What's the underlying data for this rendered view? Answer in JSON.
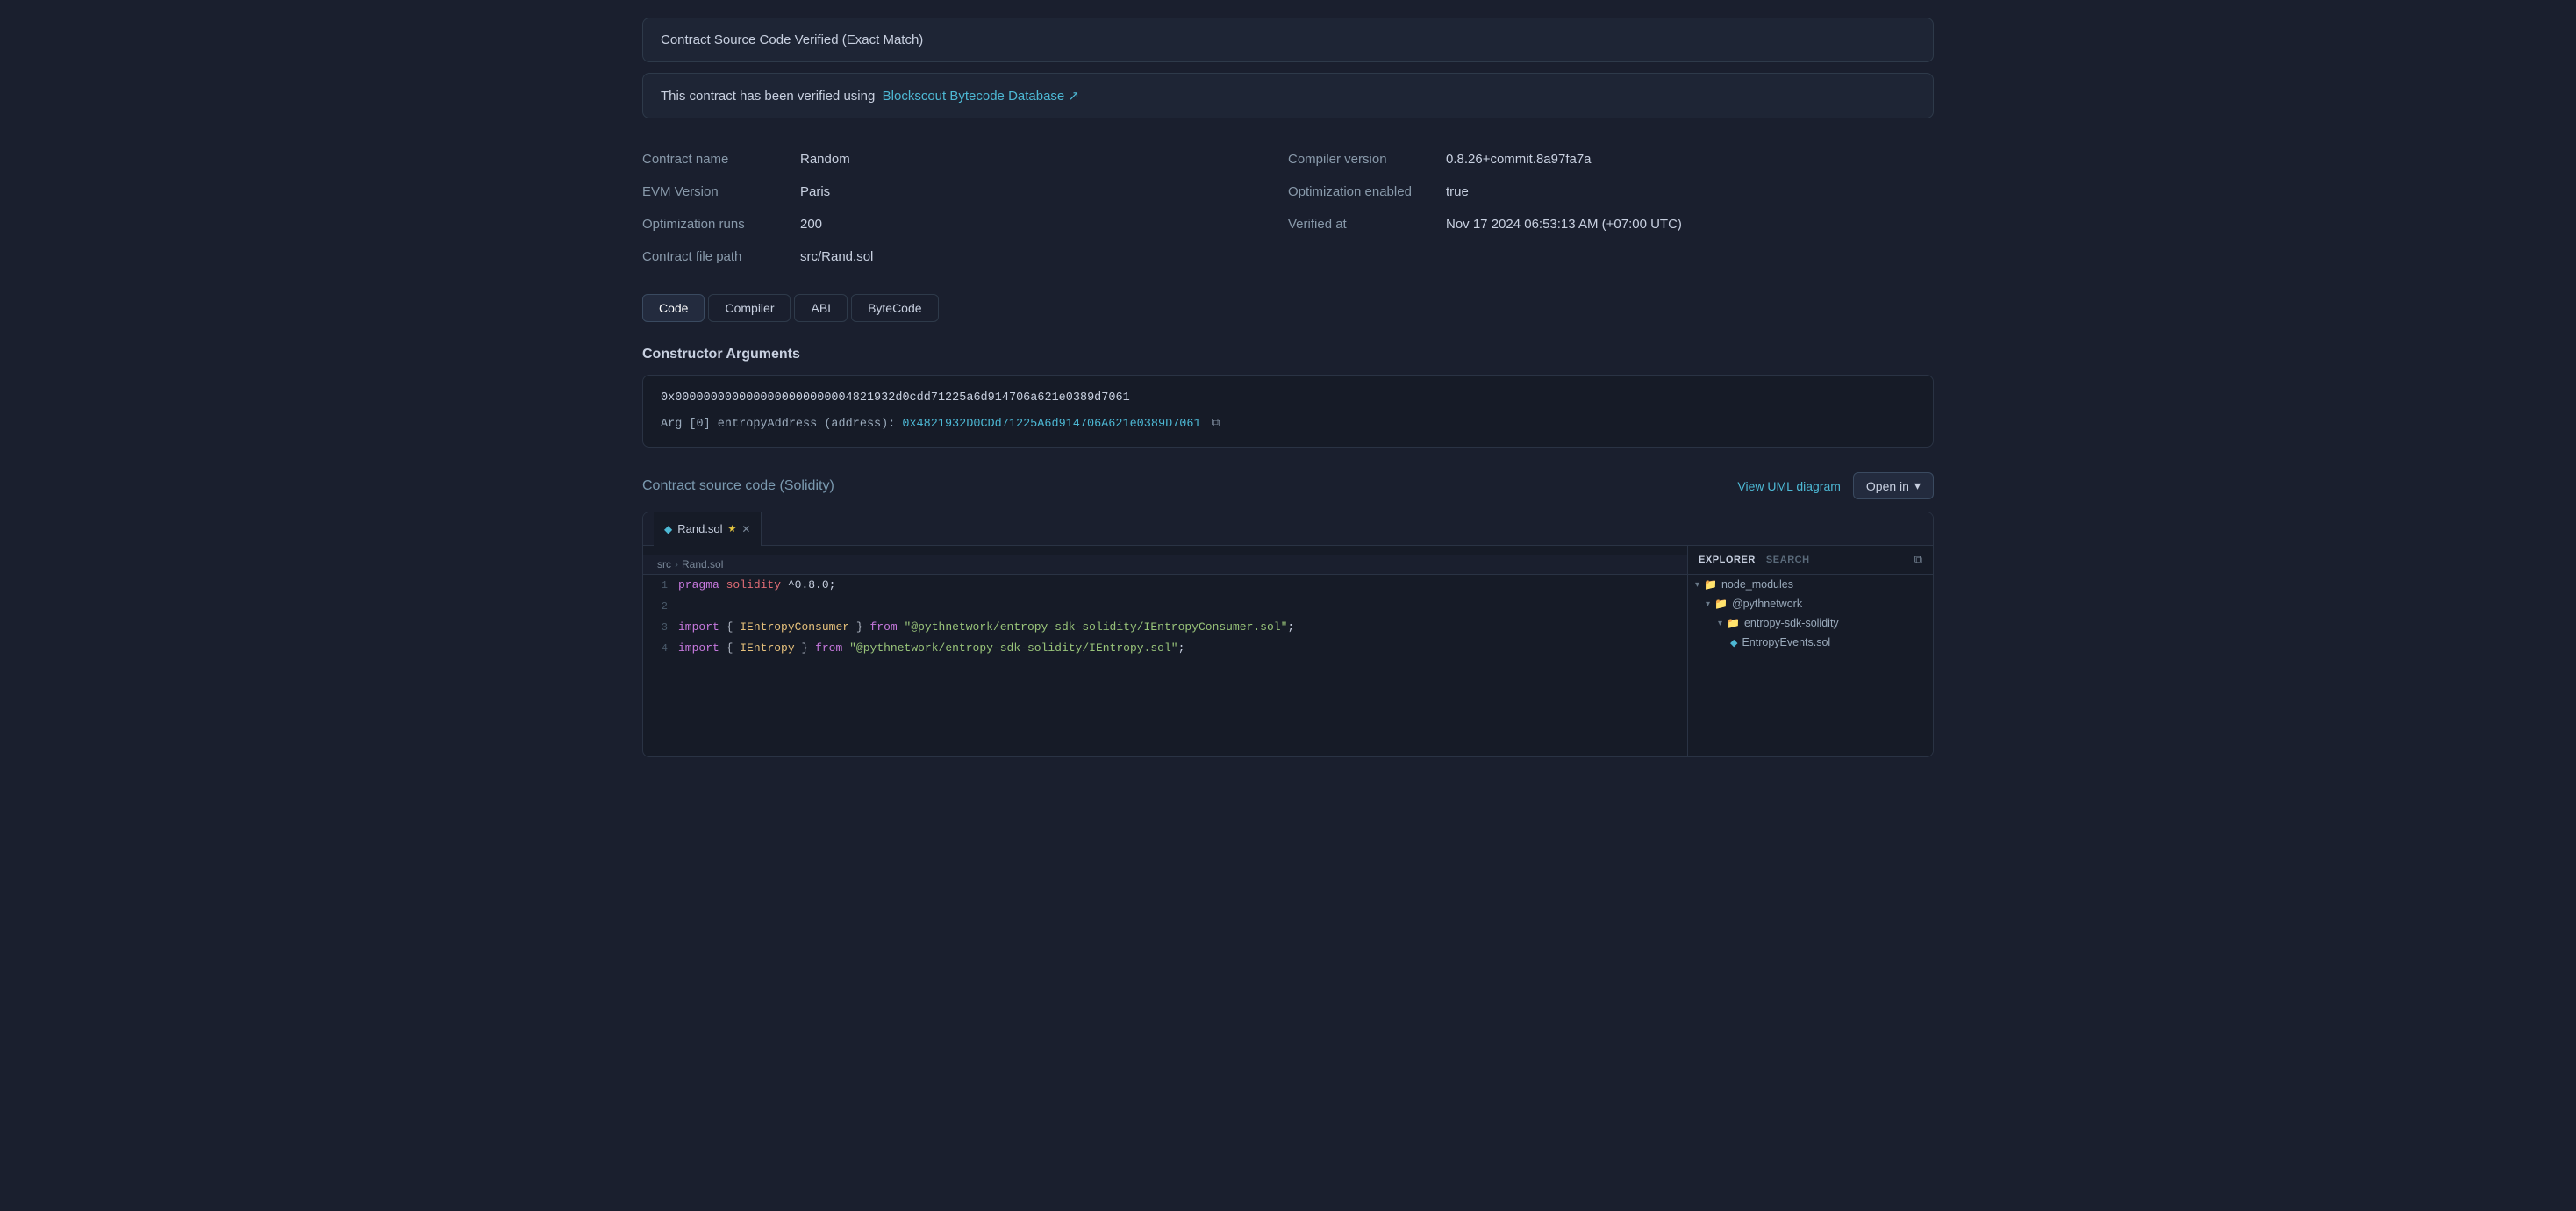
{
  "alerts": {
    "verified": "Contract Source Code Verified (Exact Match)",
    "bytecodeDb": "This contract has been verified using",
    "bytecodeLink": "Blockscout Bytecode Database ↗"
  },
  "contractInfo": {
    "left": [
      {
        "label": "Contract name",
        "value": "Random"
      },
      {
        "label": "EVM Version",
        "value": "Paris"
      },
      {
        "label": "Optimization runs",
        "value": "200"
      },
      {
        "label": "Contract file path",
        "value": "src/Rand.sol"
      }
    ],
    "right": [
      {
        "label": "Compiler version",
        "value": "0.8.26+commit.8a97fa7a"
      },
      {
        "label": "Optimization enabled",
        "value": "true"
      },
      {
        "label": "Verified at",
        "value": "Nov 17 2024 06:53:13 AM (+07:00 UTC)"
      }
    ]
  },
  "tabs": [
    "Code",
    "Compiler",
    "ABI",
    "ByteCode"
  ],
  "activeTab": "Code",
  "sections": {
    "constructorTitle": "Constructor Arguments",
    "constructorHex": "0x0000000000000000000000004821932d0cdd71225a6d914706a621e0389d7061",
    "constructorArgLabel": "Arg [0] entropyAddress (address):",
    "constructorArgValue": "0x4821932D0CDd71225A6d914706A621e0389D7061",
    "sourceTitle": "Contract source code",
    "sourceLang": "(Solidity)",
    "viewUmlLabel": "View UML diagram",
    "openInLabel": "Open in"
  },
  "editor": {
    "fileTab": "Rand.sol",
    "breadcrumb": [
      "src",
      "Rand.sol"
    ],
    "lines": [
      {
        "num": 1,
        "content": "pragma solidity ^0.8.0;"
      },
      {
        "num": 2,
        "content": ""
      },
      {
        "num": 3,
        "content": "import { IEntropyConsumer } from \"@pythnetwork/entropy-sdk-solidity/IEntropyConsumer.sol\";"
      },
      {
        "num": 4,
        "content": "import { IEntropy } from \"@pythnetwork/entropy-sdk-solidity/IEntropy.sol\";"
      }
    ]
  },
  "explorer": {
    "tabs": [
      "EXPLORER",
      "SEARCH"
    ],
    "tree": [
      {
        "label": "node_modules",
        "type": "folder",
        "level": 0,
        "expanded": true
      },
      {
        "label": "@pythnetwork",
        "type": "folder",
        "level": 1,
        "expanded": true
      },
      {
        "label": "entropy-sdk-solidity",
        "type": "folder",
        "level": 2,
        "expanded": true
      },
      {
        "label": "EntropyEvents.sol",
        "type": "file",
        "level": 3
      }
    ]
  }
}
